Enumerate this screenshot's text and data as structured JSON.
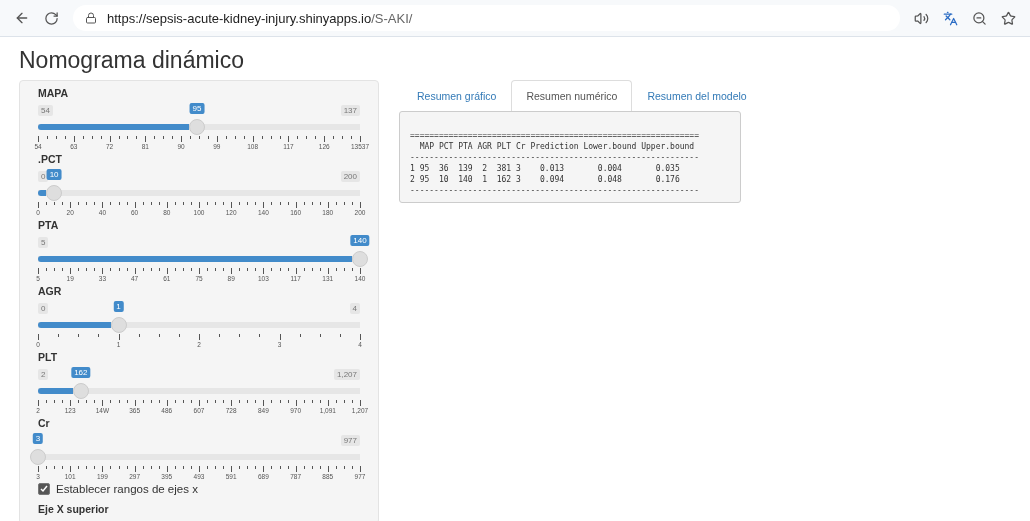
{
  "browser": {
    "url_host": "https://sepsis-acute-kidney-injury.shinyapps.io",
    "url_path": "/S-AKI/"
  },
  "page_title": "Nomograma dinámico",
  "sliders": [
    {
      "label": "MAPA",
      "min": "54",
      "max": "137",
      "value": "95",
      "level": 0.494,
      "ticks": [
        "54",
        "63",
        "72",
        "81",
        "90",
        "99",
        "108",
        "117",
        "126",
        "13537"
      ]
    },
    {
      "label": ".PCT",
      "min": "0",
      "max": "200",
      "value": "10",
      "level": 0.05,
      "ticks": [
        "0",
        "20",
        "40",
        "60",
        "80",
        "100",
        "120",
        "140",
        "160",
        "180",
        "200"
      ]
    },
    {
      "label": "PTA",
      "min": "5",
      "value": "140",
      "level": 1,
      "ticks": [
        "5",
        "19",
        "33",
        "47",
        "61",
        "75",
        "89",
        "103",
        "117",
        "131",
        "140"
      ]
    },
    {
      "label": "AGR",
      "min": "0",
      "max": "4",
      "value": "1",
      "level": 0.25,
      "ticks": [
        "0",
        "1",
        "2",
        "3",
        "4"
      ]
    },
    {
      "label": "PLT",
      "min": "2",
      "max": "1,207",
      "value": "162",
      "level": 0.133,
      "ticks": [
        "2",
        "123",
        "14W",
        "365",
        "486",
        "607",
        "728",
        "849",
        "970",
        "1,091",
        "1,207"
      ]
    },
    {
      "label": "Cr",
      "max": "977",
      "value": "3",
      "level": 0,
      "ticks": [
        "3",
        "101",
        "199",
        "297",
        "395",
        "493",
        "591",
        "689",
        "787",
        "885",
        "977"
      ]
    }
  ],
  "checkbox": {
    "label": "Establecer rangos de ejes x",
    "checked": true
  },
  "section_label": "Eje X superior",
  "tabs": [
    {
      "label": "Resumen gráfico",
      "selected": false
    },
    {
      "label": "Resumen numérico",
      "selected": true
    },
    {
      "label": "Resumen del modelo",
      "selected": false
    }
  ],
  "output": [
    "============================================================",
    "  MAP PCT PTA AGR PLT Cr Prediction Lower.bound Upper.bound",
    "------------------------------------------------------------",
    "1 95  36  139  2  381 3    0.013       0.004       0.035",
    "2 95  10  140  1  162 3    0.094       0.048       0.176",
    "------------------------------------------------------------"
  ]
}
